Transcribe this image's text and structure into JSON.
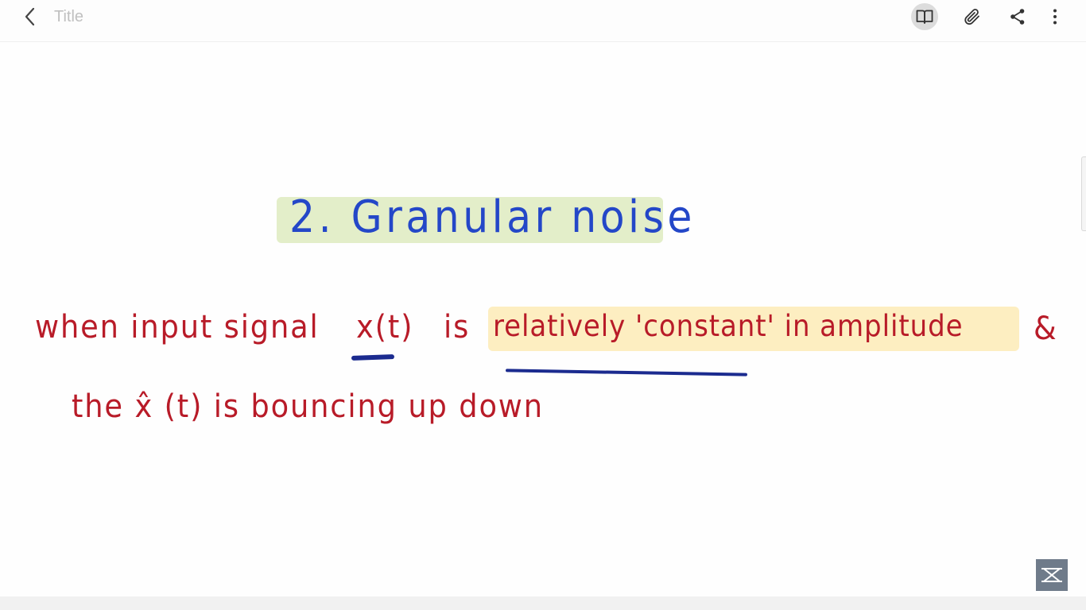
{
  "header": {
    "title_placeholder": "Title",
    "icons": {
      "back": "chevron-left-icon",
      "reading_mode": "book-open-icon",
      "attach": "paperclip-icon",
      "share": "share-icon",
      "more": "more-vertical-icon"
    }
  },
  "note": {
    "heading": "2. Granular noise",
    "line1": {
      "part1": "when  input  signal",
      "part2": "x(t)",
      "part3": "is",
      "part4": "relatively 'constant' in amplitude",
      "part5": "&"
    },
    "line2": "the  x̂ (t)  is  bouncing  up down"
  },
  "colors": {
    "heading_ink": "#2447c8",
    "heading_highlight": "#e3eec9",
    "note_ink": "#b81b28",
    "note_highlight": "#fdeec1",
    "underline_ink": "#1b2b8f"
  }
}
